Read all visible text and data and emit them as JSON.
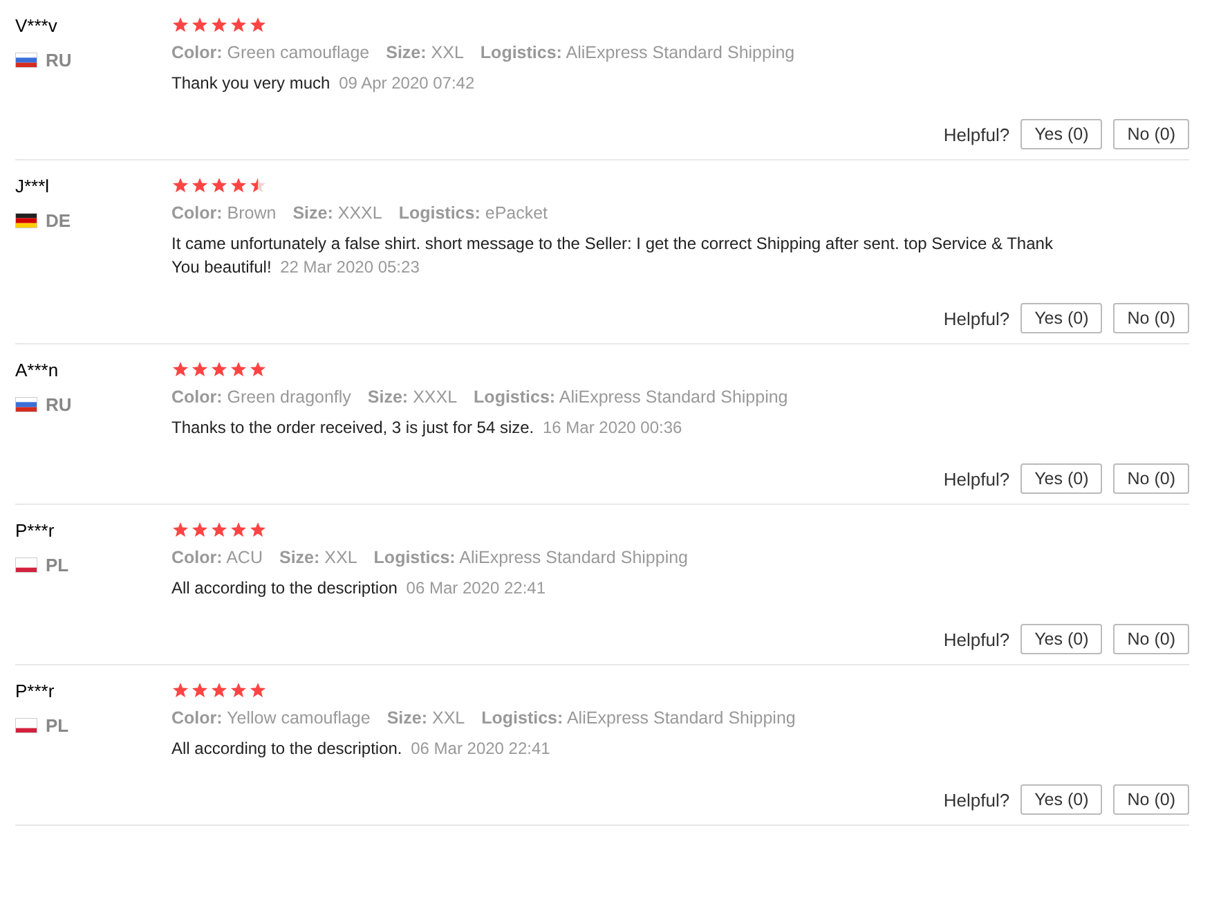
{
  "reviews": [
    {
      "user": "V***v",
      "flag": {
        "kind": "ru"
      },
      "country": "RU",
      "stars": 5,
      "attributes": [
        {
          "label": "Color:",
          "value": "Green camouflage"
        },
        {
          "label": "Size:",
          "value": "XXL"
        },
        {
          "label": "Logistics:",
          "value": "AliExpress Standard Shipping"
        }
      ],
      "text": "Thank you very much",
      "date": "09 Apr 2020 07:42",
      "helpful_label": "Helpful?",
      "yes": "Yes (0)",
      "no": "No (0)"
    },
    {
      "user": "J***l",
      "flag": {
        "kind": "de"
      },
      "country": "DE",
      "stars": 4.5,
      "attributes": [
        {
          "label": "Color:",
          "value": "Brown"
        },
        {
          "label": "Size:",
          "value": "XXXL"
        },
        {
          "label": "Logistics:",
          "value": "ePacket"
        }
      ],
      "text": "It came unfortunately a false shirt. short message to the Seller: I get the correct Shipping after sent. top Service & Thank You beautiful!",
      "date": "22 Mar 2020 05:23",
      "helpful_label": "Helpful?",
      "yes": "Yes (0)",
      "no": "No (0)"
    },
    {
      "user": "A***n",
      "flag": {
        "kind": "ru"
      },
      "country": "RU",
      "stars": 5,
      "attributes": [
        {
          "label": "Color:",
          "value": "Green dragonfly"
        },
        {
          "label": "Size:",
          "value": "XXXL"
        },
        {
          "label": "Logistics:",
          "value": "AliExpress Standard Shipping"
        }
      ],
      "text": "Thanks to the order received, 3 is just for 54 size.",
      "date": "16 Mar 2020 00:36",
      "helpful_label": "Helpful?",
      "yes": "Yes (0)",
      "no": "No (0)"
    },
    {
      "user": "P***r",
      "flag": {
        "kind": "pl"
      },
      "country": "PL",
      "stars": 5,
      "attributes": [
        {
          "label": "Color:",
          "value": "ACU"
        },
        {
          "label": "Size:",
          "value": "XXL"
        },
        {
          "label": "Logistics:",
          "value": "AliExpress Standard Shipping"
        }
      ],
      "text": "All according to the description",
      "date": "06 Mar 2020 22:41",
      "helpful_label": "Helpful?",
      "yes": "Yes (0)",
      "no": "No (0)"
    },
    {
      "user": "P***r",
      "flag": {
        "kind": "pl"
      },
      "country": "PL",
      "stars": 5,
      "attributes": [
        {
          "label": "Color:",
          "value": "Yellow camouflage"
        },
        {
          "label": "Size:",
          "value": "XXL"
        },
        {
          "label": "Logistics:",
          "value": "AliExpress Standard Shipping"
        }
      ],
      "text": "All according to the description.",
      "date": "06 Mar 2020 22:41",
      "helpful_label": "Helpful?",
      "yes": "Yes (0)",
      "no": "No (0)"
    }
  ]
}
